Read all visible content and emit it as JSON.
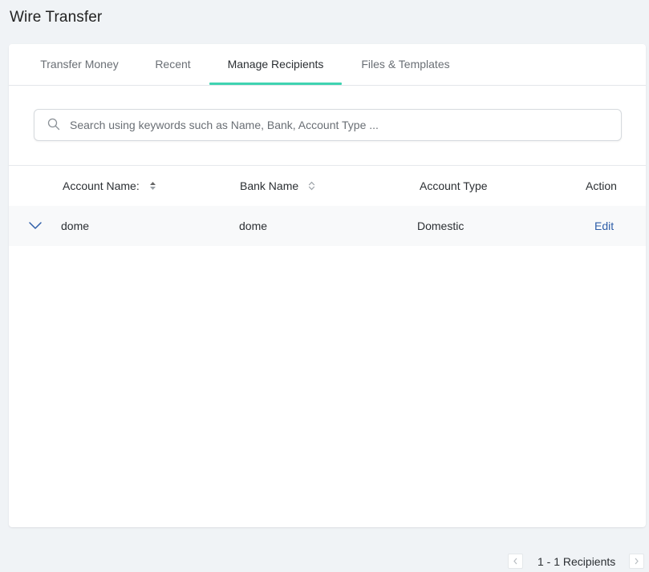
{
  "page": {
    "title": "Wire Transfer"
  },
  "tabs": [
    {
      "label": "Transfer Money",
      "active": false
    },
    {
      "label": "Recent",
      "active": false
    },
    {
      "label": "Manage Recipients",
      "active": true
    },
    {
      "label": "Files & Templates",
      "active": false
    }
  ],
  "search": {
    "placeholder": "Search using keywords such as Name, Bank, Account Type ...",
    "value": "",
    "icon": "search-icon"
  },
  "table": {
    "columns": [
      "Account Name:",
      "Bank Name",
      "Account Type",
      "Action"
    ],
    "rows": [
      {
        "account_name": "dome",
        "bank_name": "dome",
        "account_type": "Domestic",
        "action": "Edit"
      }
    ]
  },
  "pagination": {
    "summary": "1 - 1 Recipients"
  },
  "colors": {
    "accent": "#3fd3b1",
    "link": "#2e5ea8",
    "background": "#f0f3f6"
  }
}
